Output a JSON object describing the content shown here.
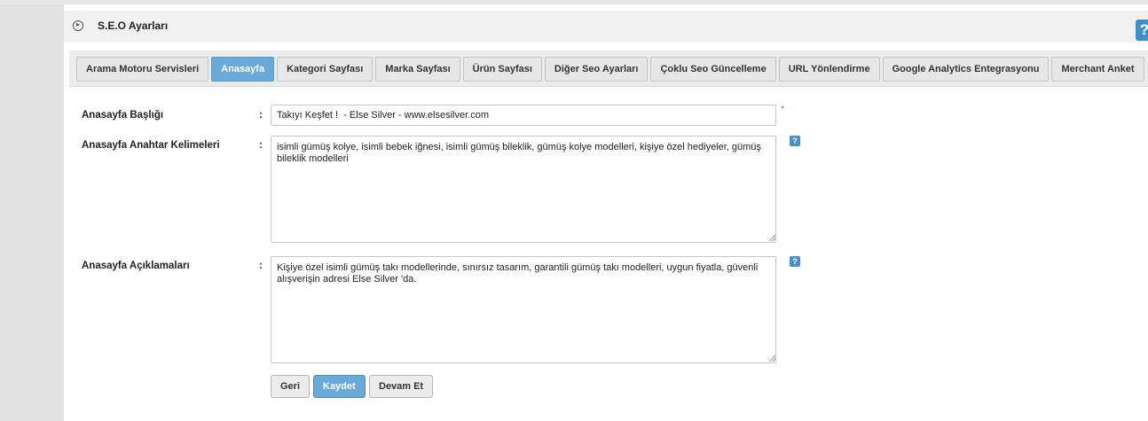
{
  "header": {
    "title": "S.E.O Ayarları",
    "help_label": "?"
  },
  "tabs": [
    {
      "label": "Arama Motoru Servisleri",
      "active": false
    },
    {
      "label": "Anasayfa",
      "active": true
    },
    {
      "label": "Kategori Sayfası",
      "active": false
    },
    {
      "label": "Marka Sayfası",
      "active": false
    },
    {
      "label": "Ürün Sayfası",
      "active": false
    },
    {
      "label": "Diğer Seo Ayarları",
      "active": false
    },
    {
      "label": "Çoklu Seo Güncelleme",
      "active": false
    },
    {
      "label": "URL Yönlendirme",
      "active": false
    },
    {
      "label": "Google Analytics Entegrasyonu",
      "active": false
    },
    {
      "label": "Merchant Anket",
      "active": false
    }
  ],
  "form": {
    "colon": ":",
    "required_mark": "*",
    "help_label": "?",
    "title_field": {
      "label": "Anasayfa Başlığı",
      "value": "Takıyı Keşfet !  - Else Silver - www.elsesilver.com"
    },
    "keywords_field": {
      "label": "Anasayfa Anahtar Kelimeleri",
      "value": "isimli gümüş kolye, isimli bebek iğnesi, isimli gümüş bileklik, gümüş kolye modelleri, kişiye özel hediyeler, gümüş bileklik modelleri"
    },
    "description_field": {
      "label": "Anasayfa Açıklamaları",
      "value": "Kişiye özel isimli gümüş takı modellerinde, sınırsız tasarım, garantili gümüş takı modelleri, uygun fiyatla, güvenli alışverişin adresi Else Silver 'da."
    }
  },
  "buttons": {
    "back": "Geri",
    "save": "Kaydet",
    "continue": "Devam Et"
  },
  "colors": {
    "accent": "#6aaad9",
    "help": "#4b8fc8",
    "required": "#d9534f"
  }
}
